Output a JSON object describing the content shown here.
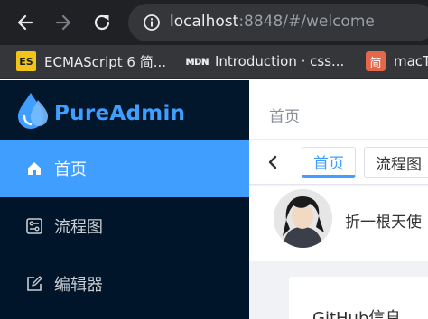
{
  "browser": {
    "url_host": "localhost",
    "url_rest": ":8848/#/welcome",
    "bookmarks": [
      {
        "label": "ECMAScript 6 简...",
        "icon": "es-icon",
        "icon_text": "ES"
      },
      {
        "label": "Introduction · css...",
        "icon": "mdn-icon",
        "icon_text": "ᴍᴅɴ"
      },
      {
        "label": "macT",
        "icon": "jian-icon",
        "icon_text": "简"
      }
    ]
  },
  "sidebar": {
    "logo_text": "PureAdmin",
    "items": [
      {
        "label": "首页",
        "icon": "home-icon",
        "active": true
      },
      {
        "label": "流程图",
        "icon": "flowchart-icon",
        "active": false
      },
      {
        "label": "编辑器",
        "icon": "edit-icon",
        "active": false
      }
    ]
  },
  "header": {
    "breadcrumb": "首页"
  },
  "tabs": [
    {
      "label": "首页",
      "active": true
    },
    {
      "label": "流程图",
      "active": false
    }
  ],
  "user_card": {
    "name": "折一根天使"
  },
  "github_card": {
    "title": "GitHub信息"
  },
  "colors": {
    "accent": "#409eff",
    "sidebar_bg": "#001529",
    "chrome_bg": "#202124"
  }
}
